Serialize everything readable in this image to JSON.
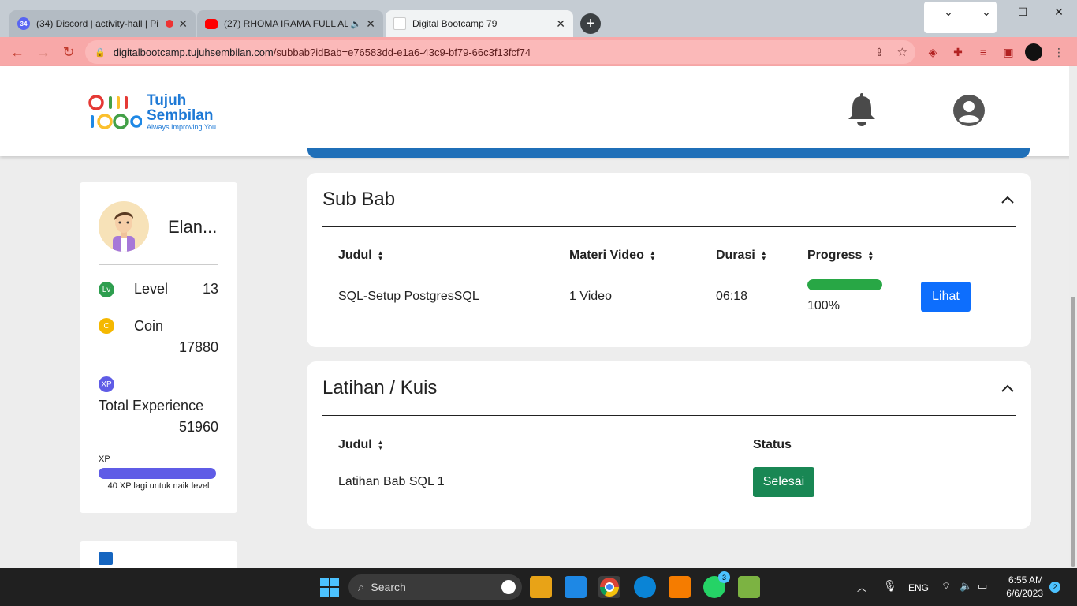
{
  "browser": {
    "tabs": [
      {
        "title": "(34) Discord | activity-hall | Pi",
        "badge": "34"
      },
      {
        "title": "(27) RHOMA IRAMA FULL AL",
        "badge": ""
      },
      {
        "title": "Digital Bootcamp 79",
        "badge": ""
      }
    ],
    "url_host": "digitalbootcamp.tujuhsembilan.com",
    "url_path": "/subbab?idBab=e76583dd-e1a6-43c9-bf79-66c3f13fcf74",
    "new_tab": "+",
    "close": "✕"
  },
  "logo": {
    "line1": "Tujuh",
    "line2": "Sembilan",
    "tagline": "Always Improving You"
  },
  "profile": {
    "name": "Elan...",
    "level_badge": "Lv",
    "level_label": "Level",
    "level_value": "13",
    "coin_badge": "C",
    "coin_label": "Coin",
    "coin_value": "17880",
    "xp_badge": "XP",
    "xp_total_label": "Total Experience",
    "xp_total_value": "51960",
    "xp_bar_label": "XP",
    "xp_progress": 0.99,
    "xp_note": "40 XP lagi untuk naik level"
  },
  "subbab": {
    "title": "Sub Bab",
    "columns": [
      "Judul",
      "Materi Video",
      "Durasi",
      "Progress"
    ],
    "rows": [
      {
        "judul": "SQL-Setup PostgresSQL",
        "materi": "1 Video",
        "durasi": "06:18",
        "progress": 100,
        "progress_text": "100%",
        "action": "Lihat"
      }
    ]
  },
  "latihan": {
    "title": "Latihan / Kuis",
    "columns": [
      "Judul",
      "Status"
    ],
    "rows": [
      {
        "judul": "Latihan Bab SQL 1",
        "status": "Selesai"
      }
    ]
  },
  "taskbar": {
    "search": "Search",
    "lang": "ENG",
    "time": "6:55 AM",
    "date": "6/6/2023",
    "notif_count": "2",
    "whatsapp_badge": "3"
  },
  "colors": {
    "primary_button": "#0d6efd",
    "success_button": "#198754",
    "progress_fill": "#28a745",
    "xp_bar": "#5f5ce6",
    "address_bar": "#f8a8a8"
  }
}
